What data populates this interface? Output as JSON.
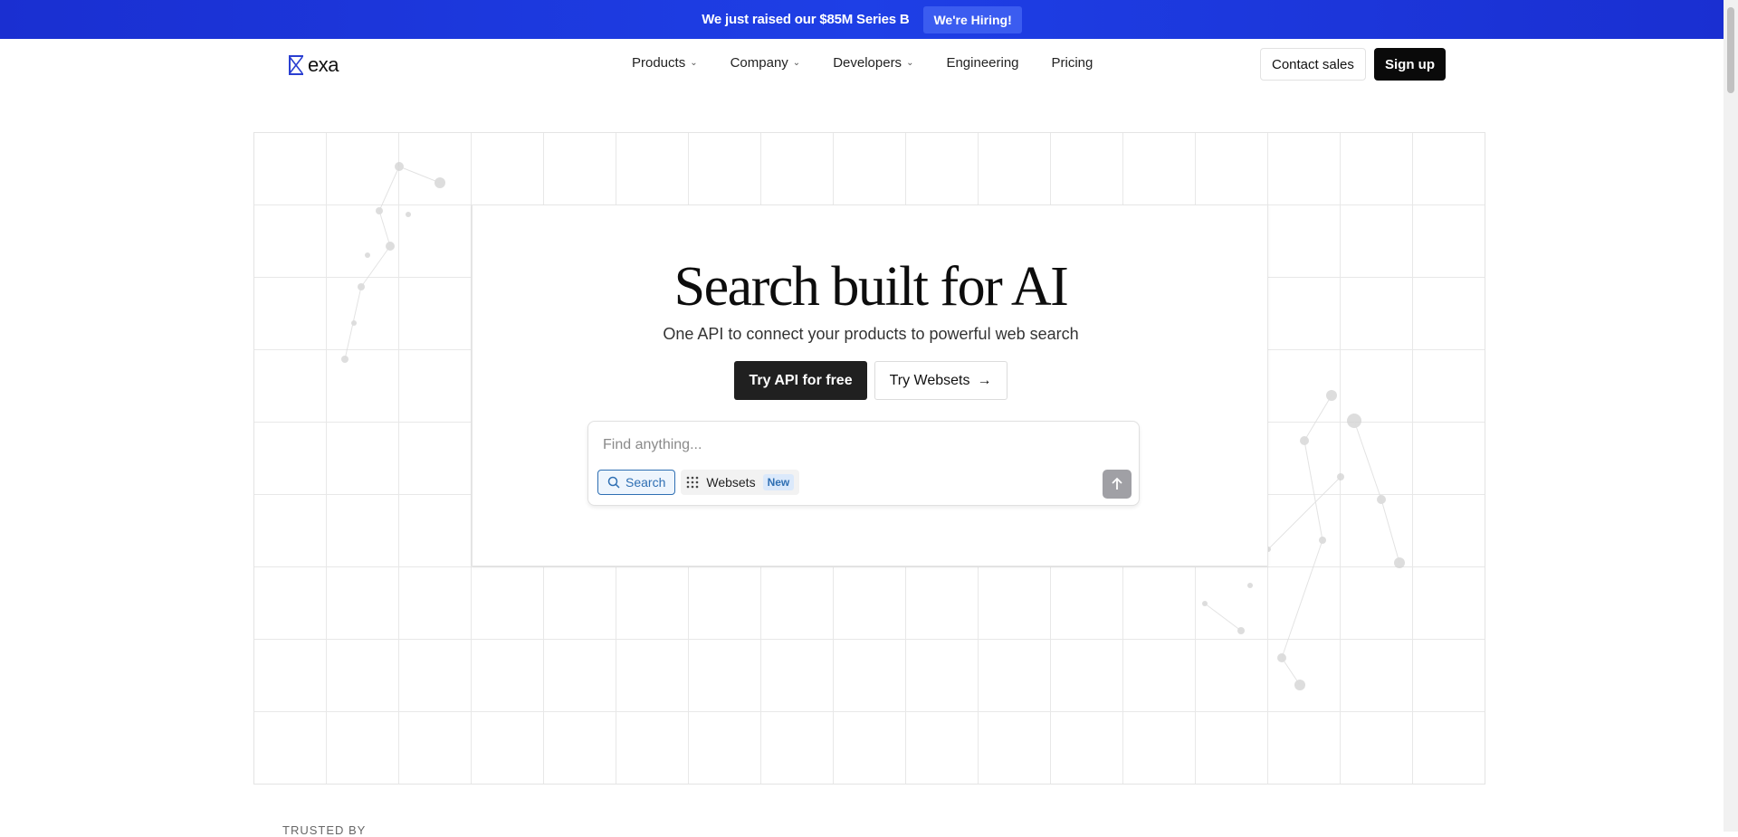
{
  "announcement": {
    "text": "We just raised our $85M Series B",
    "button_label": "We're Hiring!"
  },
  "nav": {
    "logo_text": "exa",
    "links": [
      {
        "label": "Products",
        "has_dropdown": true
      },
      {
        "label": "Company",
        "has_dropdown": true
      },
      {
        "label": "Developers",
        "has_dropdown": true
      },
      {
        "label": "Engineering",
        "has_dropdown": false
      },
      {
        "label": "Pricing",
        "has_dropdown": false
      }
    ],
    "contact_label": "Contact sales",
    "signup_label": "Sign up"
  },
  "hero": {
    "title": "Search built for AI",
    "subtitle": "One API to connect your products to powerful web search",
    "primary_cta": "Try API for free",
    "secondary_cta": "Try Websets",
    "secondary_icon": "arrow-right-icon"
  },
  "search": {
    "placeholder": "Find anything...",
    "modes": {
      "search_label": "Search",
      "websets_label": "Websets",
      "websets_badge": "New"
    },
    "submit_icon": "arrow-up-icon"
  },
  "footer_hint": {
    "trusted_label": "TRUSTED BY"
  },
  "colors": {
    "announce_bg": "#1e3fe6",
    "accent_blue": "#2f6fb3",
    "primary_dark": "#202020"
  }
}
